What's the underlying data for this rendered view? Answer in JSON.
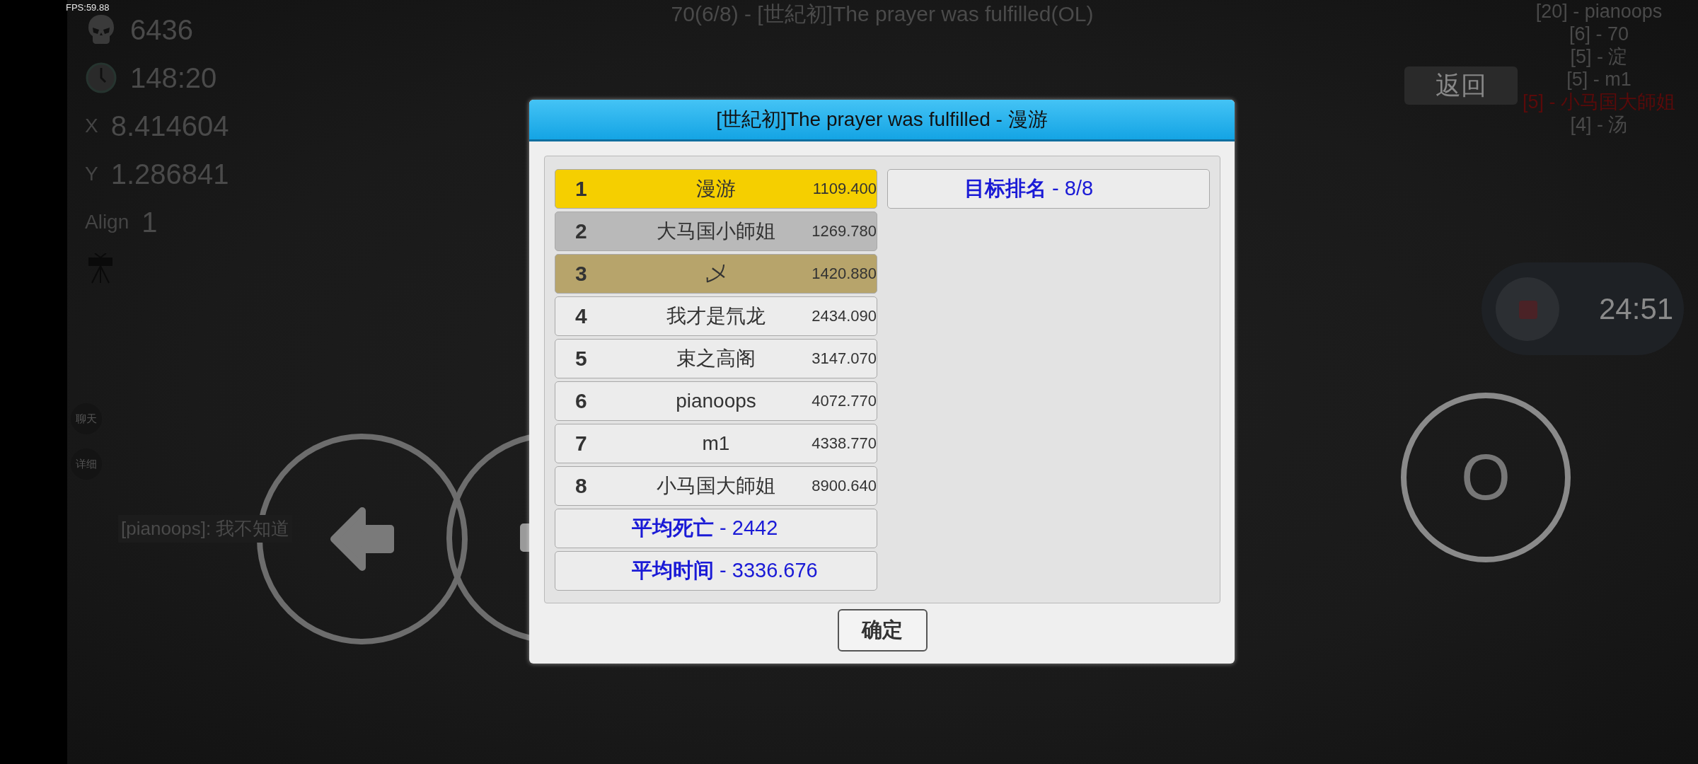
{
  "fps": "FPS:59.88",
  "room_title": "70(6/8) - [世紀初]The prayer was fulfilled(OL)",
  "hud": [
    {
      "kind": "skull",
      "value": "6436"
    },
    {
      "kind": "clock",
      "value": "148:20"
    },
    {
      "kind": "label",
      "label": "X",
      "value": "8.414604"
    },
    {
      "kind": "label",
      "label": "Y",
      "value": "1.286841"
    },
    {
      "kind": "label",
      "label": "Align",
      "value": "1"
    }
  ],
  "side_buttons": [
    "聊天",
    "详细"
  ],
  "chat_message": "[pianoops]: 我不知道",
  "player_list": [
    {
      "text": "[20] - pianoops",
      "color": "#4a4a4a"
    },
    {
      "text": "[6] - 70",
      "color": "#4a4a4a"
    },
    {
      "text": "[5] - 淀",
      "color": "#4a4a4a"
    },
    {
      "text": "[5] - m1",
      "color": "#4a4a4a"
    },
    {
      "text": "[5] - 小马国大師姐",
      "color": "#5a0a0a"
    },
    {
      "text": "[4] - 汤",
      "color": "#4a4a4a"
    }
  ],
  "back_button": "返回",
  "recording": {
    "time": "24:51"
  },
  "action_button": "O",
  "dialog": {
    "title": "[世紀初]The prayer was fulfilled - 漫游",
    "rows": [
      {
        "rank": "1",
        "name": "漫游",
        "score": "1109.400",
        "color": "#f5cf00"
      },
      {
        "rank": "2",
        "name": "大马国小師姐",
        "score": "1269.780",
        "color": "#b9b9b9"
      },
      {
        "rank": "3",
        "name": "乄",
        "score": "1420.880",
        "color": "#b7a46b"
      },
      {
        "rank": "4",
        "name": "我才是氘龙",
        "score": "2434.090",
        "color": "#ececec"
      },
      {
        "rank": "5",
        "name": "束之高阁",
        "score": "3147.070",
        "color": "#ececec"
      },
      {
        "rank": "6",
        "name": "pianoops",
        "score": "4072.770",
        "color": "#ececec"
      },
      {
        "rank": "7",
        "name": "m1",
        "score": "4338.770",
        "color": "#ececec"
      },
      {
        "rank": "8",
        "name": "小马国大師姐",
        "score": "8900.640",
        "color": "#ececec"
      }
    ],
    "stats": [
      "**平均死亡** - 2442",
      "**平均时间** - 3336.676"
    ],
    "target": "**目标排名** - 8/8",
    "ok_button": "确定"
  }
}
